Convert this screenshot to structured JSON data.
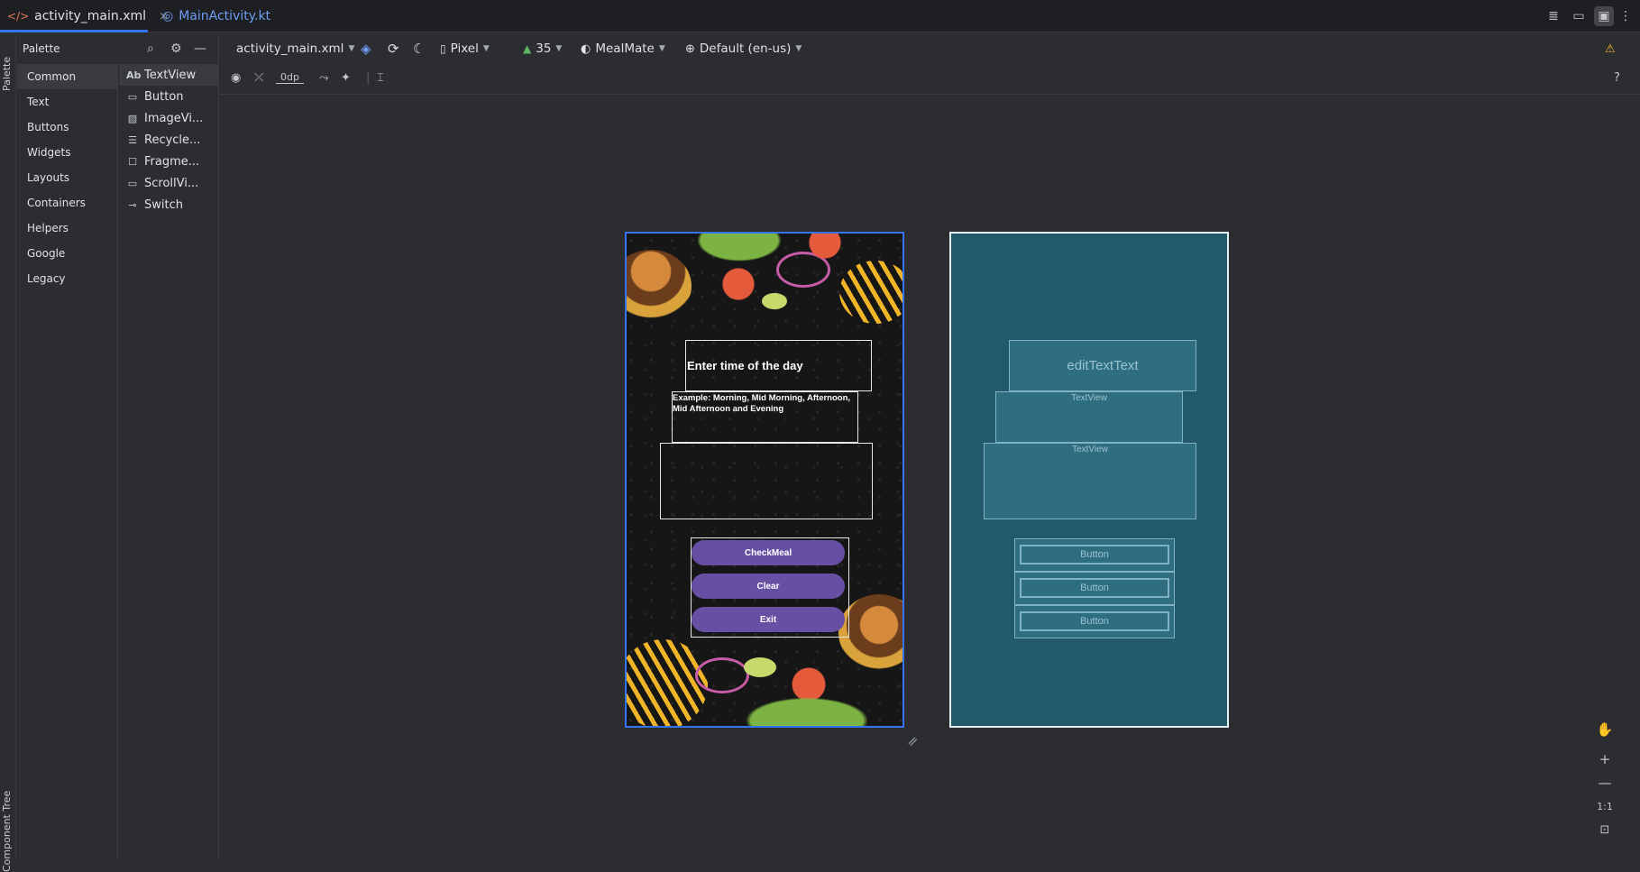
{
  "tabs": [
    {
      "label": "activity_main.xml",
      "icon": "xml-code-icon",
      "close": "×",
      "active": true
    },
    {
      "label": "MainActivity.kt",
      "icon": "kotlin-class-icon",
      "active": false
    }
  ],
  "side_strip": {
    "palette_label": "Palette",
    "component_tree_label": "Component Tree"
  },
  "palette": {
    "title": "Palette",
    "categories": [
      "Common",
      "Text",
      "Buttons",
      "Widgets",
      "Layouts",
      "Containers",
      "Helpers",
      "Google",
      "Legacy"
    ],
    "selected_category": "Common",
    "components": [
      {
        "icon_text": "Ab",
        "label": "TextView"
      },
      {
        "label": "Button"
      },
      {
        "label": "ImageVi..."
      },
      {
        "label": "Recycle..."
      },
      {
        "label": "Fragme..."
      },
      {
        "label": "ScrollVi..."
      },
      {
        "label": "Switch"
      }
    ]
  },
  "toolbar": {
    "file_dropdown": "activity_main.xml",
    "device": "Pixel",
    "api_level": "35",
    "theme": "MealMate",
    "locale": "Default (en-us)",
    "default_margin": "0dp"
  },
  "design": {
    "title_text": "Enter time of the day",
    "example_text": "Example: Morning, Mid Morning, Afternoon, Mid Afternoon and Evening",
    "buttons": [
      "CheckMeal",
      "Clear",
      "Exit"
    ]
  },
  "blueprint": {
    "edit_text": "editTextText",
    "textview_1": "TextView",
    "textview_2": "TextView",
    "buttons": [
      "Button",
      "Button",
      "Button"
    ]
  },
  "zoom_controls": {
    "plus": "+",
    "minus": "—",
    "one_to_one": "1:1"
  },
  "colors": {
    "accent": "#3574f0",
    "button_purple": "#6750a4",
    "blueprint_bg": "#235a6b"
  }
}
